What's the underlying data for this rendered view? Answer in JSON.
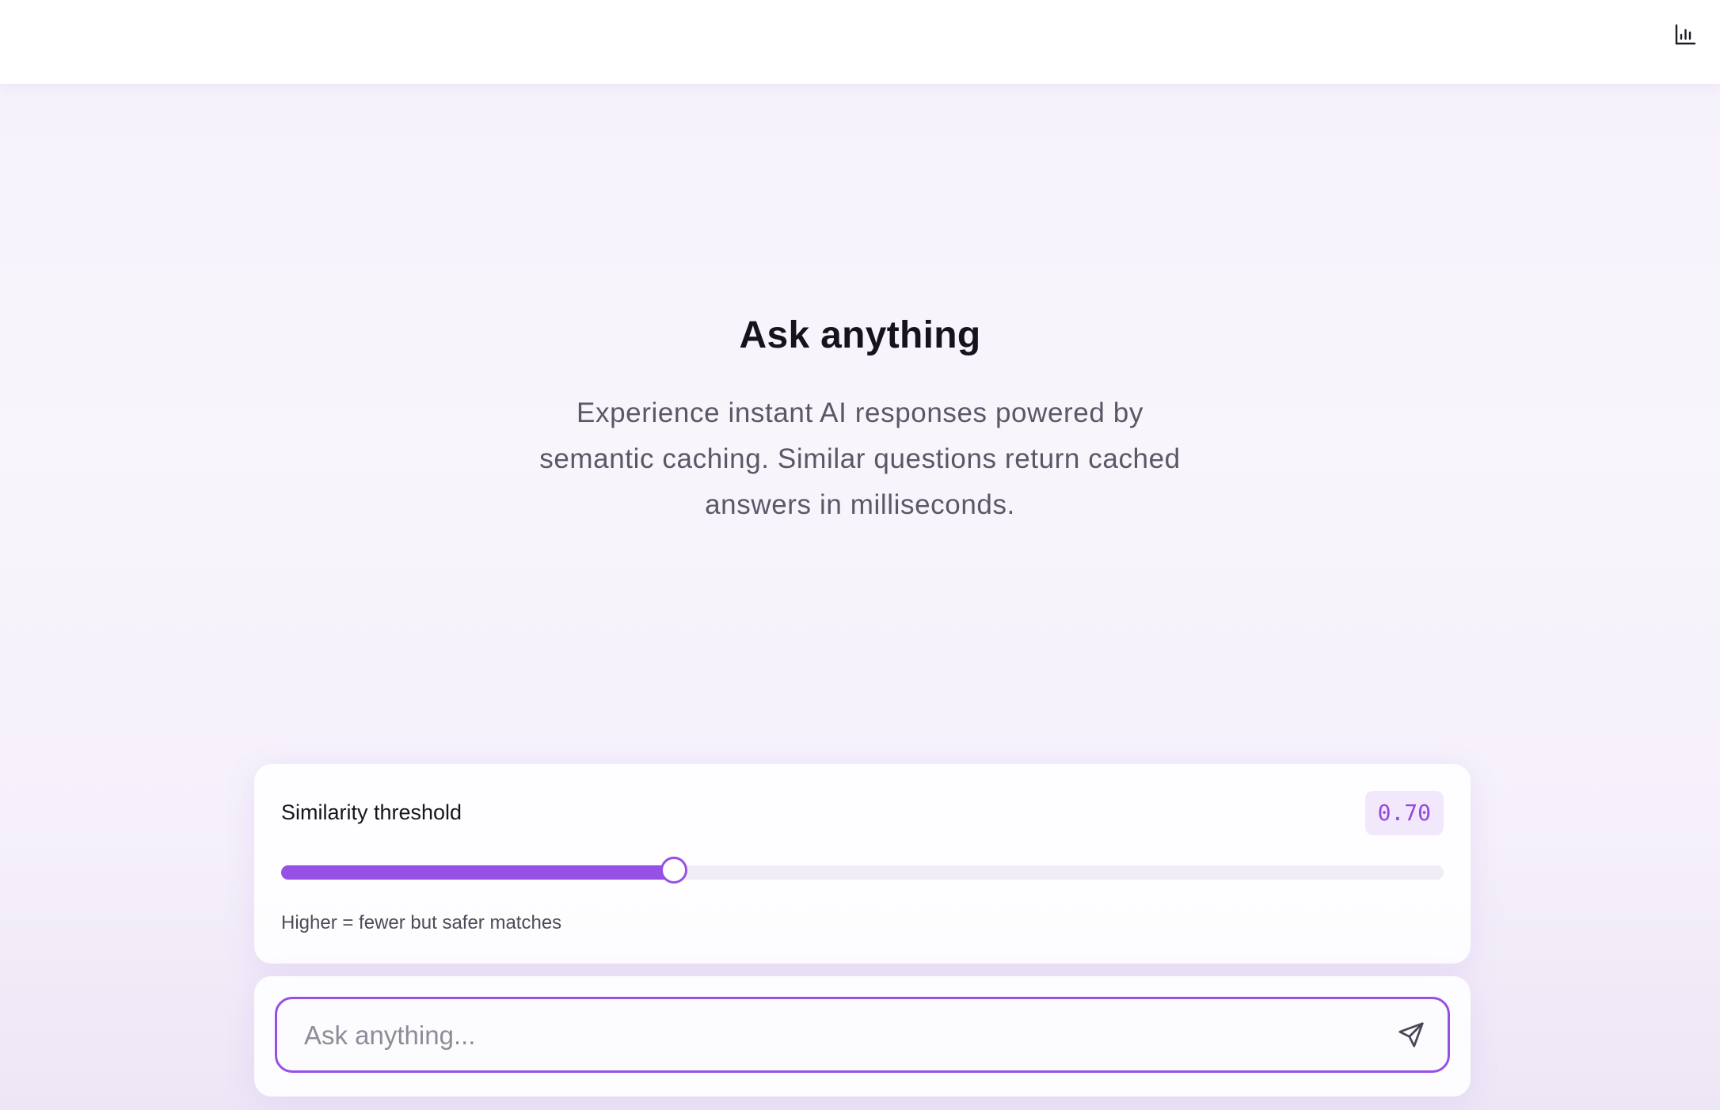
{
  "header": {
    "stats_icon": "bar-chart-icon"
  },
  "hero": {
    "title": "Ask anything",
    "subtitle": "Experience instant AI responses powered by semantic caching. Similar questions return cached answers in milliseconds."
  },
  "threshold": {
    "label": "Similarity threshold",
    "value_display": "0.70",
    "value": 0.7,
    "slider_fill_fraction": 0.338,
    "hint": "Higher = fewer but safer matches"
  },
  "chat": {
    "placeholder": "Ask anything...",
    "value": "",
    "send_icon": "send-icon"
  },
  "colors": {
    "accent": "#9750e4",
    "value_badge_bg": "#f1e8fb",
    "value_text": "#9647de",
    "title_text": "#16131c",
    "subtitle_text": "#5c5768"
  }
}
